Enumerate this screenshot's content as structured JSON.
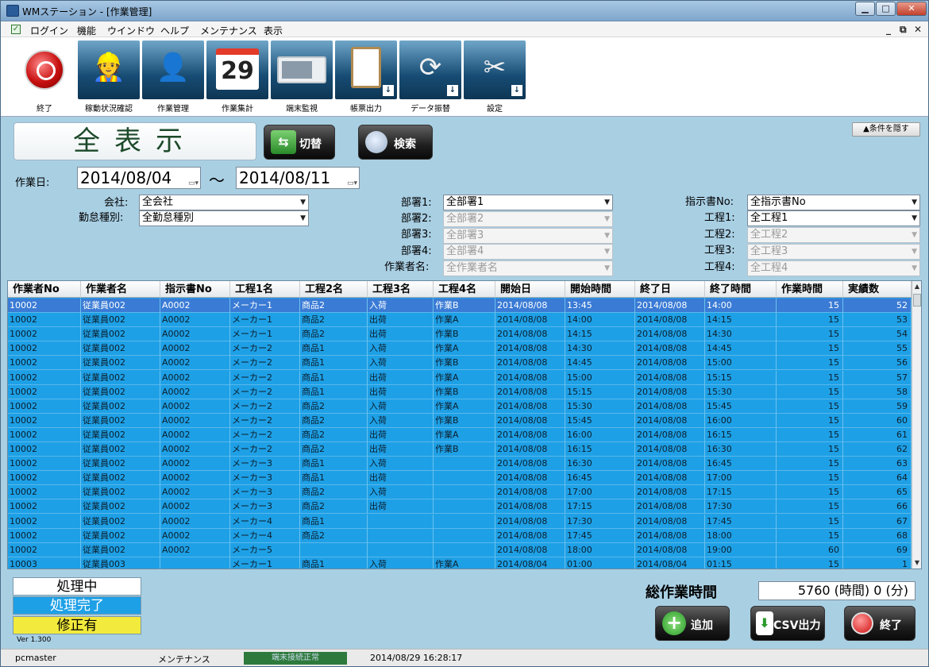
{
  "window": {
    "title": "WMステーション - [作業管理]"
  },
  "menu": {
    "items": [
      "ログイン",
      "機能",
      "ウインドウ",
      "ヘルプ",
      "メンテナンス",
      "表示"
    ],
    "mdi_controls": [
      "_",
      "⧉",
      "✕"
    ]
  },
  "toolbar": {
    "items": [
      {
        "label": "終了",
        "icon": "power-icon"
      },
      {
        "label": "稼動状況確認",
        "icon": "worker-wrench-icon"
      },
      {
        "label": "作業管理",
        "icon": "person-icon"
      },
      {
        "label": "作業集計",
        "icon": "calendar-chart-icon",
        "glyph": "29"
      },
      {
        "label": "端末監視",
        "icon": "terminal-icon"
      },
      {
        "label": "帳票出力",
        "icon": "clipboard-icon"
      },
      {
        "label": "データ振替",
        "icon": "sync-icon"
      },
      {
        "label": "設定",
        "icon": "tools-icon"
      }
    ]
  },
  "display_mode": "全表示",
  "buttons": {
    "switch": "切替",
    "search": "検索",
    "hide_conditions": "▲条件を隠す",
    "add": "追加",
    "csv": "CSV出力",
    "exit": "終了"
  },
  "filters": {
    "work_date_label": "作業日:",
    "date_from": "2014/08/04",
    "date_to": "2014/08/11",
    "tilde": "～",
    "company_label": "会社:",
    "company": "全会社",
    "attendance_label": "勤怠種別:",
    "attendance": "全勤怠種別",
    "dept1_label": "部署1:",
    "dept1": "全部署1",
    "dept2_label": "部署2:",
    "dept2": "全部署2",
    "dept3_label": "部署3:",
    "dept3": "全部署3",
    "dept4_label": "部署4:",
    "dept4": "全部署4",
    "worker_label": "作業者名:",
    "worker": "全作業者名",
    "order_label": "指示書No:",
    "order": "全指示書No",
    "proc1_label": "工程1:",
    "proc1": "全工程1",
    "proc2_label": "工程2:",
    "proc2": "全工程2",
    "proc3_label": "工程3:",
    "proc3": "全工程3",
    "proc4_label": "工程4:",
    "proc4": "全工程4"
  },
  "table": {
    "headers": [
      "作業者No",
      "作業者名",
      "指示書No",
      "工程1名",
      "工程2名",
      "工程3名",
      "工程4名",
      "開始日",
      "開始時間",
      "終了日",
      "終了時間",
      "作業時間",
      "実績数"
    ],
    "rows": [
      [
        "10002",
        "従業員002",
        "A0002",
        "メーカー1",
        "商品2",
        "入荷",
        "作業B",
        "2014/08/08",
        "13:45",
        "2014/08/08",
        "14:00",
        "15",
        "52"
      ],
      [
        "10002",
        "従業員002",
        "A0002",
        "メーカー1",
        "商品2",
        "出荷",
        "作業A",
        "2014/08/08",
        "14:00",
        "2014/08/08",
        "14:15",
        "15",
        "53"
      ],
      [
        "10002",
        "従業員002",
        "A0002",
        "メーカー1",
        "商品2",
        "出荷",
        "作業B",
        "2014/08/08",
        "14:15",
        "2014/08/08",
        "14:30",
        "15",
        "54"
      ],
      [
        "10002",
        "従業員002",
        "A0002",
        "メーカー2",
        "商品1",
        "入荷",
        "作業A",
        "2014/08/08",
        "14:30",
        "2014/08/08",
        "14:45",
        "15",
        "55"
      ],
      [
        "10002",
        "従業員002",
        "A0002",
        "メーカー2",
        "商品1",
        "入荷",
        "作業B",
        "2014/08/08",
        "14:45",
        "2014/08/08",
        "15:00",
        "15",
        "56"
      ],
      [
        "10002",
        "従業員002",
        "A0002",
        "メーカー2",
        "商品1",
        "出荷",
        "作業A",
        "2014/08/08",
        "15:00",
        "2014/08/08",
        "15:15",
        "15",
        "57"
      ],
      [
        "10002",
        "従業員002",
        "A0002",
        "メーカー2",
        "商品1",
        "出荷",
        "作業B",
        "2014/08/08",
        "15:15",
        "2014/08/08",
        "15:30",
        "15",
        "58"
      ],
      [
        "10002",
        "従業員002",
        "A0002",
        "メーカー2",
        "商品2",
        "入荷",
        "作業A",
        "2014/08/08",
        "15:30",
        "2014/08/08",
        "15:45",
        "15",
        "59"
      ],
      [
        "10002",
        "従業員002",
        "A0002",
        "メーカー2",
        "商品2",
        "入荷",
        "作業B",
        "2014/08/08",
        "15:45",
        "2014/08/08",
        "16:00",
        "15",
        "60"
      ],
      [
        "10002",
        "従業員002",
        "A0002",
        "メーカー2",
        "商品2",
        "出荷",
        "作業A",
        "2014/08/08",
        "16:00",
        "2014/08/08",
        "16:15",
        "15",
        "61"
      ],
      [
        "10002",
        "従業員002",
        "A0002",
        "メーカー2",
        "商品2",
        "出荷",
        "作業B",
        "2014/08/08",
        "16:15",
        "2014/08/08",
        "16:30",
        "15",
        "62"
      ],
      [
        "10002",
        "従業員002",
        "A0002",
        "メーカー3",
        "商品1",
        "入荷",
        "",
        "2014/08/08",
        "16:30",
        "2014/08/08",
        "16:45",
        "15",
        "63"
      ],
      [
        "10002",
        "従業員002",
        "A0002",
        "メーカー3",
        "商品1",
        "出荷",
        "",
        "2014/08/08",
        "16:45",
        "2014/08/08",
        "17:00",
        "15",
        "64"
      ],
      [
        "10002",
        "従業員002",
        "A0002",
        "メーカー3",
        "商品2",
        "入荷",
        "",
        "2014/08/08",
        "17:00",
        "2014/08/08",
        "17:15",
        "15",
        "65"
      ],
      [
        "10002",
        "従業員002",
        "A0002",
        "メーカー3",
        "商品2",
        "出荷",
        "",
        "2014/08/08",
        "17:15",
        "2014/08/08",
        "17:30",
        "15",
        "66"
      ],
      [
        "10002",
        "従業員002",
        "A0002",
        "メーカー4",
        "商品1",
        "",
        "",
        "2014/08/08",
        "17:30",
        "2014/08/08",
        "17:45",
        "15",
        "67"
      ],
      [
        "10002",
        "従業員002",
        "A0002",
        "メーカー4",
        "商品2",
        "",
        "",
        "2014/08/08",
        "17:45",
        "2014/08/08",
        "18:00",
        "15",
        "68"
      ],
      [
        "10002",
        "従業員002",
        "A0002",
        "メーカー5",
        "",
        "",
        "",
        "2014/08/08",
        "18:00",
        "2014/08/08",
        "19:00",
        "60",
        "69"
      ],
      [
        "10003",
        "従業員003",
        "",
        "メーカー1",
        "商品1",
        "入荷",
        "作業A",
        "2014/08/04",
        "01:00",
        "2014/08/04",
        "01:15",
        "15",
        "1"
      ]
    ]
  },
  "legend": {
    "processing": "処理中",
    "done": "処理完了",
    "modified": "修正有",
    "version": "Ver 1.300"
  },
  "total": {
    "label": "総作業時間",
    "value": "5760 (時間) 0 (分)"
  },
  "status": {
    "user": "pcmaster",
    "mode": "メンテナンス",
    "connection": "端末接続正常",
    "datetime": "2014/08/29 16:28:17"
  },
  "colors": {
    "background": "#a9cfe3",
    "row_done": "#1ea0e6",
    "row_selected": "#3a7bd5",
    "modified": "#f2ea3c",
    "connection_ok": "#2e7a3c"
  }
}
